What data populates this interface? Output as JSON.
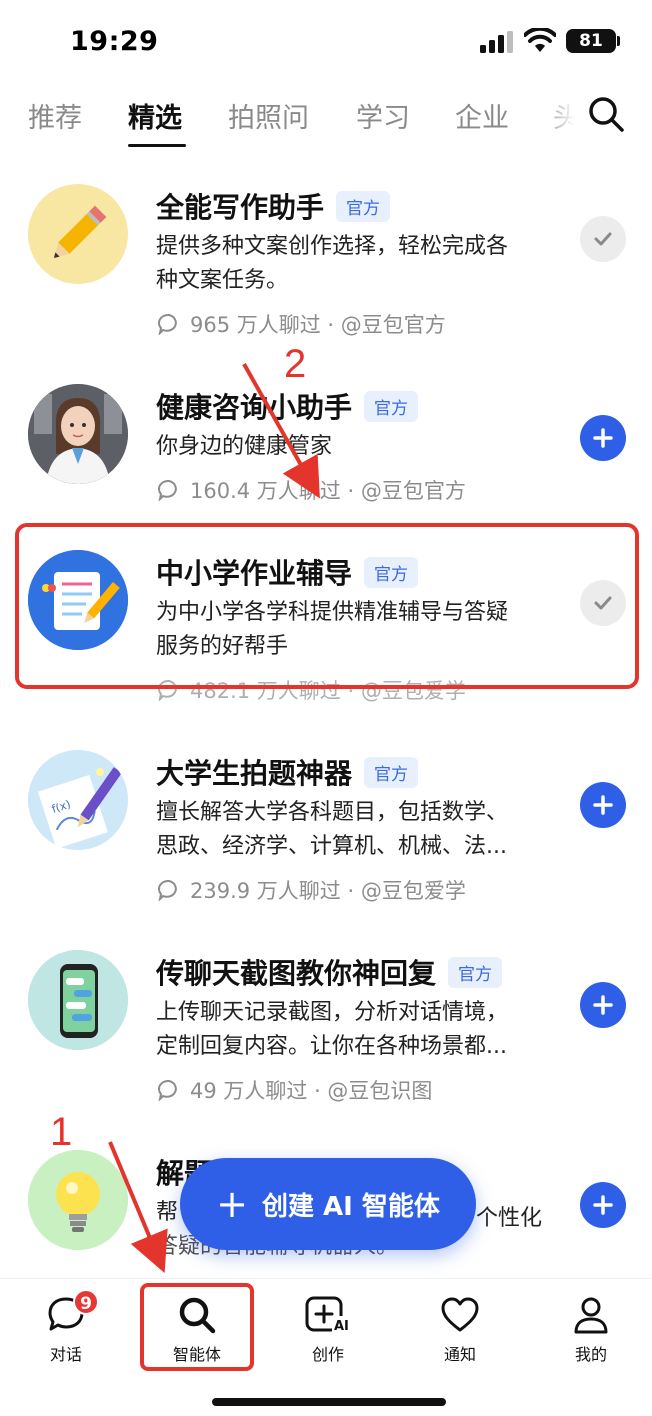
{
  "status_bar": {
    "time": "19:29",
    "battery": "81"
  },
  "tabs": [
    {
      "label": "推荐"
    },
    {
      "label": "精选",
      "active": true
    },
    {
      "label": "拍照问"
    },
    {
      "label": "学习"
    },
    {
      "label": "企业"
    },
    {
      "label": "头"
    }
  ],
  "agents": [
    {
      "title": "全能写作助手",
      "badge": "官方",
      "desc_lines": [
        "提供多种文案创作选择，轻松完成各",
        "种文案任务。"
      ],
      "stats": "965 万人聊过 · @豆包官方",
      "state": "added",
      "icon": "pencil-icon"
    },
    {
      "title": "健康咨询小助手",
      "badge": "官方",
      "desc_lines": [
        "你身边的健康管家"
      ],
      "stats": "160.4 万人聊过 · @豆包官方",
      "state": "add",
      "icon": "doctor-avatar"
    },
    {
      "title": "中小学作业辅导",
      "badge": "官方",
      "desc_lines": [
        "为中小学各学科提供精准辅导与答疑",
        "服务的好帮手"
      ],
      "stats": "482.1 万人聊过 · @豆包爱学",
      "state": "added",
      "icon": "notebook-icon"
    },
    {
      "title": "大学生拍题神器",
      "badge": "官方",
      "desc_lines": [
        "擅长解答大学各科题目，包括数学、",
        "思政、经济学、计算机、机械、法..."
      ],
      "stats": "239.9 万人聊过 · @豆包爱学",
      "state": "add",
      "icon": "math-paper-icon"
    },
    {
      "title": "传聊天截图教你神回复",
      "badge": "官方",
      "desc_lines": [
        "上传聊天记录截图，分析对话情境，",
        "定制回复内容。让你在各种场景都..."
      ],
      "stats": "49 万人聊过 · @豆包识图",
      "state": "add",
      "icon": "phone-chat-icon"
    },
    {
      "title": "解题",
      "badge": "",
      "desc_lines": [
        "帮",
        "答疑的智能辅导机器人。"
      ],
      "desc_right": "个性化",
      "stats": "",
      "state": "add",
      "icon": "lightbulb-icon"
    }
  ],
  "fab": {
    "label": "创建 AI 智能体"
  },
  "bottom_nav": [
    {
      "label": "对话",
      "badge": "9",
      "icon": "chat-bubble-icon"
    },
    {
      "label": "智能体",
      "icon": "search-icon",
      "active": true
    },
    {
      "label": "创作",
      "icon": "create-ai-icon"
    },
    {
      "label": "通知",
      "icon": "heart-icon"
    },
    {
      "label": "我的",
      "icon": "person-icon"
    }
  ],
  "annotations": {
    "step1": "1",
    "step2": "2"
  },
  "colors": {
    "accent": "#2f5fe6",
    "badge_bg": "#e8f0fe",
    "highlight": "#e4352d"
  }
}
